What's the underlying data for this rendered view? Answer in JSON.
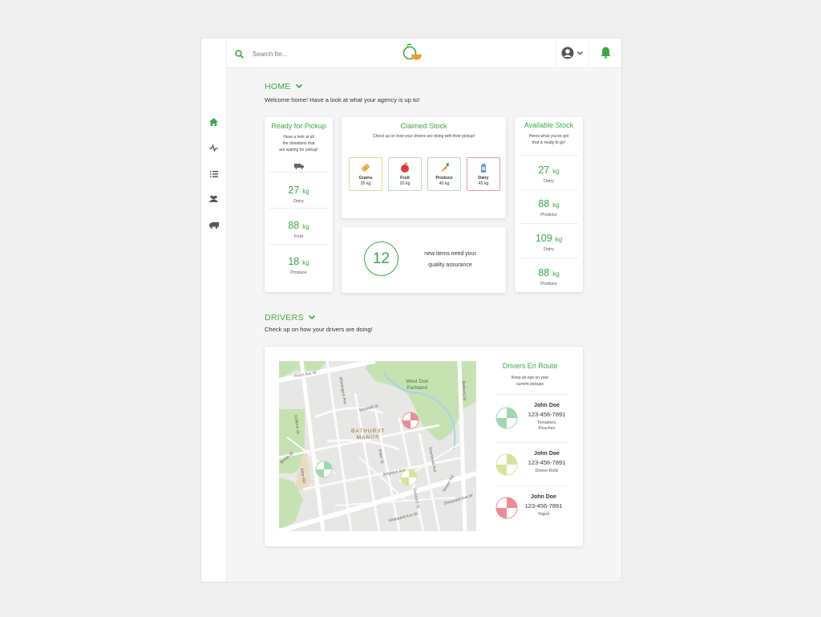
{
  "search": {
    "placeholder": "Search for..."
  },
  "home": {
    "title": "HOME",
    "subtitle": "Welcome home! Have a look at what your agency is up to!"
  },
  "ready_for_pickup": {
    "title": "Ready for Pickup",
    "description": [
      "Have a look at all",
      "the donations that",
      "are waiting for pickup!"
    ],
    "stats": [
      {
        "value": "27",
        "unit": "kg",
        "label": "Dairy"
      },
      {
        "value": "88",
        "unit": "kg",
        "label": "Fruit"
      },
      {
        "value": "18",
        "unit": "kg",
        "label": "Produce"
      }
    ]
  },
  "claimed_stock": {
    "title": "Claimed Stock",
    "description": "Check up on how your drivers are doing with their pickup!",
    "items": [
      {
        "name": "Grains",
        "amount": "35 kg",
        "icon": "bread-icon",
        "border": "#e8d690"
      },
      {
        "name": "Fruit",
        "amount": "20 kg",
        "icon": "apple-icon",
        "border": "#b9d9bc"
      },
      {
        "name": "Produce",
        "amount": "40 kg",
        "icon": "carrot-icon",
        "border": "#b9d9bc"
      },
      {
        "name": "Dairy",
        "amount": "45 kg",
        "icon": "milk-icon",
        "border": "#e597a8"
      }
    ]
  },
  "quality": {
    "count": "12",
    "line1": "new items need your",
    "line2": "quality assurance"
  },
  "available_stock": {
    "title": "Available Stock",
    "description": [
      "Heres what you've got",
      "that is ready to go!"
    ],
    "stats": [
      {
        "value": "27",
        "unit": "kg",
        "label": "Dairy"
      },
      {
        "value": "88",
        "unit": "kg",
        "label": "Produce"
      },
      {
        "value": "109",
        "unit": "kg",
        "label": "Dairy"
      },
      {
        "value": "88",
        "unit": "kg",
        "label": "Produce"
      }
    ]
  },
  "drivers": {
    "title": "DRIVERS",
    "subtitle": "Check up on how your drivers are doing!"
  },
  "map": {
    "streets": [
      "Finch Ave W",
      "Wilmington Ave",
      "Bathurst St",
      "Dufferin St",
      "Maxwell St",
      "Sheppard Ave W",
      "Elder St",
      "Brighton Ave",
      "Goddard St",
      "Senlac Rd",
      "Allen Rd",
      "Sheppard Ave W",
      "Bowie St",
      "Sherwood Ave"
    ],
    "parkland": [
      "West Don",
      "Parkland"
    ],
    "neighbourhood": [
      "BATHURST",
      "MANOR"
    ]
  },
  "en_route": {
    "title": "Drivers En Route",
    "description": [
      "Keep an eye on your",
      "current pickups"
    ],
    "drivers": [
      {
        "name": "John Doe",
        "phone": "123-456-7891",
        "items": [
          "Tomatoes,",
          "Peaches"
        ],
        "color": "#9fd8b0"
      },
      {
        "name": "John Doe",
        "phone": "123-456-7891",
        "items": [
          "Dinner Rolls"
        ],
        "color": "#d6e39b"
      },
      {
        "name": "John Doe",
        "phone": "123-456-7891",
        "items": [
          "Yogurt"
        ],
        "color": "#ec8b97"
      }
    ]
  },
  "colors": {
    "accent": "#3aa84a",
    "orange": "#f39a1e",
    "background": "#efeff0"
  }
}
